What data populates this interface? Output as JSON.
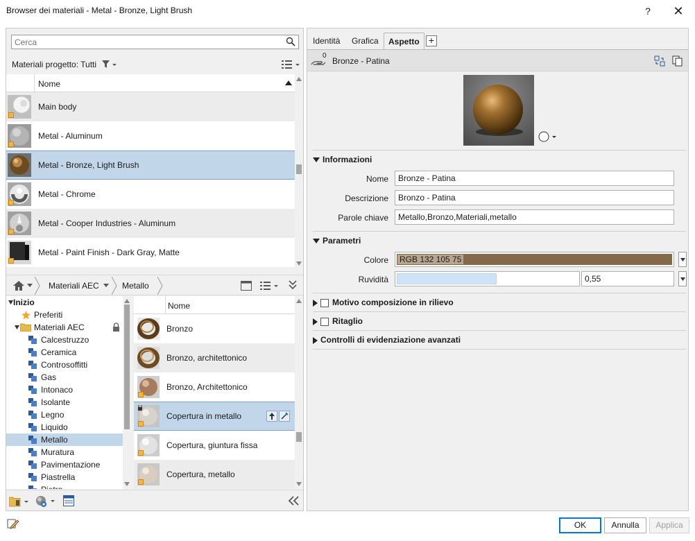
{
  "window": {
    "title": "Browser dei materiali - Metal - Bronze, Light Brush",
    "help_label": "?",
    "close_label": "✕"
  },
  "search": {
    "placeholder": "Cerca",
    "value": ""
  },
  "project": {
    "filter_label": "Materiali progetto: Tutti",
    "column_name": "Nome",
    "materials": [
      {
        "label": "Main body",
        "thumb": "white-sphere-icon"
      },
      {
        "label": "Metal - Aluminum",
        "thumb": "aluminum-sphere-icon"
      },
      {
        "label": "Metal - Bronze, Light Brush",
        "thumb": "bronze-sphere-icon"
      },
      {
        "label": "Metal - Chrome",
        "thumb": "chrome-sphere-icon"
      },
      {
        "label": "Metal - Cooper Industries - Aluminum",
        "thumb": "aluminum-sphere-icon"
      },
      {
        "label": "Metal - Paint Finish - Dark Gray, Matte",
        "thumb": "dark-cube-icon"
      }
    ]
  },
  "breadcrumb": {
    "items": [
      "Materiali AEC",
      "Metallo"
    ]
  },
  "tree": {
    "root": "Inizio",
    "favorites": "Preferiti",
    "library": "Materiali AEC",
    "categories": [
      "Calcestruzzo",
      "Ceramica",
      "Controsoffitti",
      "Gas",
      "Intonaco",
      "Isolante",
      "Legno",
      "Liquido",
      "Metallo",
      "Muratura",
      "Pavimentazione",
      "Piastrella",
      "Pietra"
    ],
    "selected": "Metallo"
  },
  "library": {
    "column_name": "Nome",
    "items": [
      {
        "label": "Bronzo",
        "thumb": "bronze-ring-icon"
      },
      {
        "label": "Bronzo, architettonico",
        "thumb": "bronze-ring-icon"
      },
      {
        "label": "Bronzo, Architettonico",
        "thumb": "copper-sphere-icon"
      },
      {
        "label": "Copertura in metallo",
        "thumb": "gray-sphere-icon"
      },
      {
        "label": "Copertura, giuntura fissa",
        "thumb": "silver-sphere-icon"
      },
      {
        "label": "Copertura, metallo",
        "thumb": "beige-sphere-icon"
      }
    ]
  },
  "tabs": [
    "Identità",
    "Grafica",
    "Aspetto"
  ],
  "active_tab": "Aspetto",
  "asset": {
    "name": "Bronze - Patina",
    "users": "0"
  },
  "info": {
    "title": "Informazioni",
    "name_label": "Nome",
    "name_value": "Bronze - Patina",
    "desc_label": "Descrizione",
    "desc_value": "Bronzo - Patina",
    "keywords_label": "Parole chiave",
    "keywords_value": "Metallo,Bronzo,Materiali,metallo"
  },
  "params": {
    "title": "Parametri",
    "color_label": "Colore",
    "color_value": "RGB 132 105 75",
    "color_hex": "#84694b",
    "roughness_label": "Ruvidità",
    "roughness_value": "0,55",
    "roughness_fraction": 0.55
  },
  "collapsed_sections": {
    "relief": "Motivo composizione in rilievo",
    "cutout": "Ritaglio",
    "advanced": "Controlli di evidenziazione avanzati"
  },
  "buttons": {
    "ok": "OK",
    "cancel": "Annulla",
    "apply": "Applica"
  },
  "colors": {
    "selection": "#c2d6ea",
    "accent": "#0078d7",
    "warning": "#f0b64c"
  }
}
